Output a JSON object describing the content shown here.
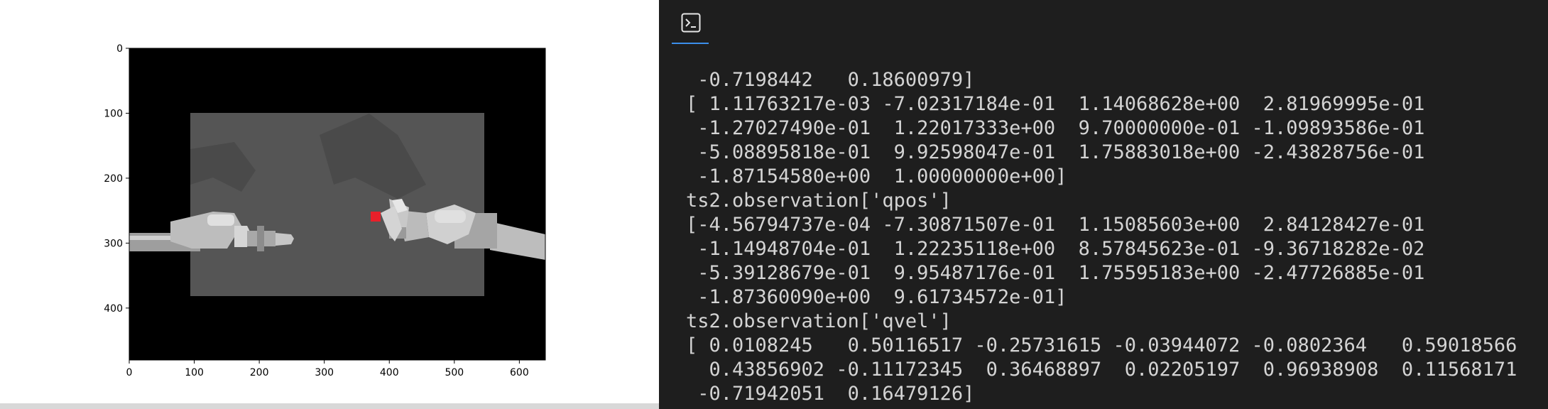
{
  "plot": {
    "image_description_label": "robot-sim-frame",
    "x_ticks": [
      "0",
      "100",
      "200",
      "300",
      "400",
      "500",
      "600"
    ],
    "y_ticks": [
      "0",
      "100",
      "200",
      "300",
      "400"
    ],
    "colors": {
      "background": "#000000",
      "table": "#555555",
      "cube": "#e8202a",
      "arm": "#bdbdbd"
    }
  },
  "terminal": {
    "icon": "terminal-prompt-icon",
    "lines": [
      " -0.7198442   0.18600979]",
      "[ 1.11763217e-03 -7.02317184e-01  1.14068628e+00  2.81969995e-01",
      " -1.27027490e-01  1.22017333e+00  9.70000000e-01 -1.09893586e-01",
      " -5.08895818e-01  9.92598047e-01  1.75883018e+00 -2.43828756e-01",
      " -1.87154580e+00  1.00000000e+00]",
      "ts2.observation['qpos']",
      "[-4.56794737e-04 -7.30871507e-01  1.15085603e+00  2.84128427e-01",
      " -1.14948704e-01  1.22235118e+00  8.57845623e-01 -9.36718282e-02",
      " -5.39128679e-01  9.95487176e-01  1.75595183e+00 -2.47726885e-01",
      " -1.87360090e+00  9.61734572e-01]",
      "ts2.observation['qvel']",
      "[ 0.0108245   0.50116517 -0.25731615 -0.03944072 -0.0802364   0.59018566",
      "  0.43856902 -0.11172345  0.36468897  0.02205197  0.96938908  0.11568171",
      " -0.71942051  0.16479126]"
    ]
  }
}
